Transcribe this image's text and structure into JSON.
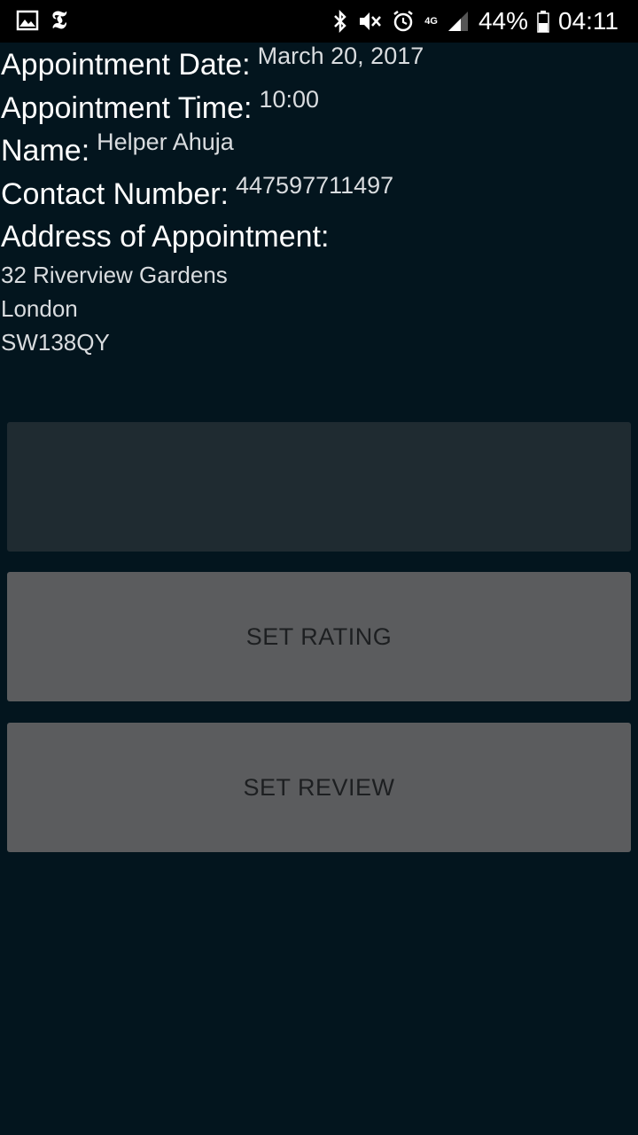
{
  "status_bar": {
    "icons_left": [
      "gallery-icon",
      "nyt-icon"
    ],
    "icons_right": [
      "bluetooth-icon",
      "vibrate-mute-icon",
      "alarm-icon",
      "network-4g-icon",
      "signal-icon",
      "battery-icon"
    ],
    "network_label": "4G",
    "battery": "44%",
    "time": "04:11"
  },
  "appointment": {
    "date_label": "Appointment Date:",
    "date_value": "March 20, 2017",
    "time_label": "Appointment Time:",
    "time_value": "10:00",
    "name_label": "Name:",
    "name_value": "Helper Ahuja",
    "contact_label": "Contact Number:",
    "contact_value": "447597711497",
    "address_label": "Address of Appointment:",
    "address_lines": [
      "32 Riverview Gardens",
      "London",
      "SW138QY"
    ]
  },
  "buttons": {
    "disabled_label": "",
    "set_rating": "SET RATING",
    "set_review": "SET REVIEW"
  },
  "colors": {
    "background": "#03151e",
    "status_bar": "#000000",
    "button_active": "#5b5c5e",
    "button_disabled": "#1f2b31"
  }
}
